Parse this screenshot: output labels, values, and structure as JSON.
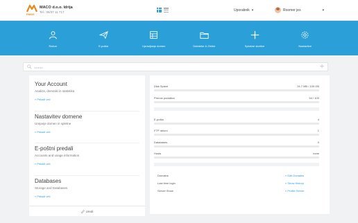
{
  "header": {
    "company_name": "MACO d.o.o. Idrija",
    "company_tel": "Tel.: 05/37 11 717",
    "logo_word": "maco",
    "language_label": "Uporabnik",
    "user_label": "Roomer jes"
  },
  "nav": [
    {
      "label": "Račun",
      "icon": "user-icon"
    },
    {
      "label": "E-pošta",
      "icon": "paper-plane-icon"
    },
    {
      "label": "Upravljanje domen",
      "icon": "domain-grid-icon"
    },
    {
      "label": "Datoteke & Zbirke",
      "icon": "folder-icon"
    },
    {
      "label": "Splošne storitve",
      "icon": "plus-icon"
    },
    {
      "label": "Nastavitve",
      "icon": "settings-icon"
    }
  ],
  "search": {
    "placeholder": "Iskanje..."
  },
  "cards": [
    {
      "title": "Your Account",
      "subtitle": "Analiza, dnevniki in statistika",
      "link": "» Prikaži več"
    },
    {
      "title": "Nastavitev domene",
      "subtitle": "Urejanje domen in spletne",
      "link": "» Prikaži več"
    },
    {
      "title": "E-poštni predali",
      "subtitle": "Accounts and usage information",
      "link": "» Prikaži več"
    },
    {
      "title": "Databases",
      "subtitle": "Storage and Databases",
      "link": "» Prikaži več"
    }
  ],
  "left_footer": {
    "label": "Uredi"
  },
  "stats": [
    {
      "label": "Disk Space",
      "value": "24.7 MB / 100 GB",
      "fraction": 0.01
    },
    {
      "label": "Prenos podatkov",
      "value": "54 / 100",
      "fraction": 0.54
    },
    {
      "label": "E-pošta",
      "value": "4",
      "fraction": 0.0
    },
    {
      "label": "FTP računi",
      "value": "1",
      "fraction": 0.0
    },
    {
      "label": "Databases",
      "value": "0",
      "fraction": 0.0
    },
    {
      "label": "Hosts",
      "value": "none",
      "fraction": 0.0
    }
  ],
  "info": [
    {
      "label": "Domains",
      "link": "» Edit Domains"
    },
    {
      "label": "Last time login",
      "link": "» Show History"
    },
    {
      "label": "Server Show",
      "link": "» Profile Server"
    }
  ],
  "colors": {
    "accent": "#2a9fd8",
    "logo": "#e58a1f"
  }
}
